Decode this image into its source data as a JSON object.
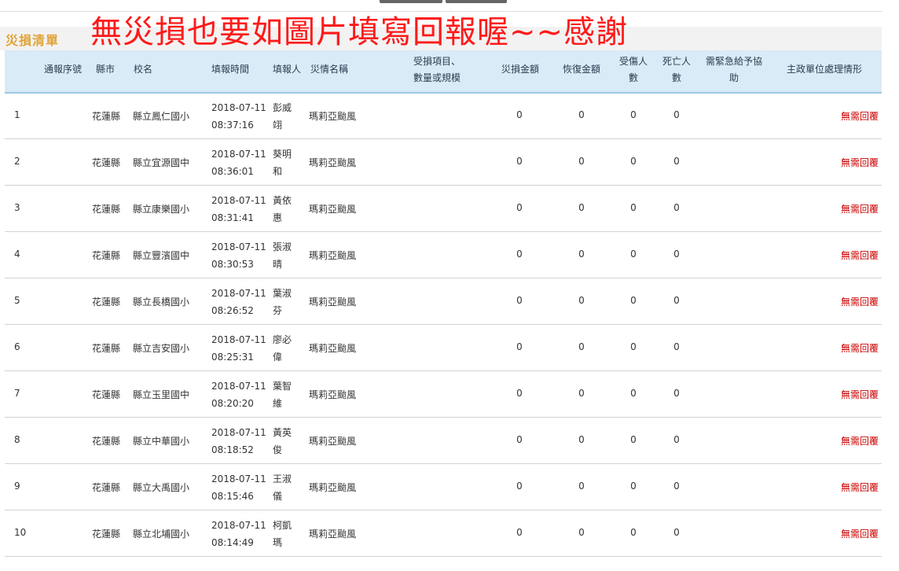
{
  "section_title": "災損清單",
  "annotation": "無災損也要如圖片填寫回報喔~~感謝",
  "headers": {
    "seq": "通報序號",
    "county": "縣市",
    "school": "校名",
    "time": "填報時間",
    "reporter": "填報人",
    "disaster": "災情名稱",
    "items_l1": "受損項目、",
    "items_l2": "數量或規模",
    "loss": "災損金額",
    "recovery": "恢復金額",
    "injured_l1": "受傷人",
    "injured_l2": "數",
    "dead_l1": "死亡人",
    "dead_l2": "數",
    "urgent_l1": "需緊急給予協",
    "urgent_l2": "助",
    "handling": "主政單位處理情形"
  },
  "rows": [
    {
      "seq": "1",
      "county": "花蓮縣",
      "school": "縣立鳳仁國小",
      "date": "2018-07-11",
      "time": "08:37:16",
      "name1": "彭威",
      "name2": "翊",
      "disaster": "瑪莉亞颱風",
      "loss": "0",
      "recovery": "0",
      "injured": "0",
      "dead": "0",
      "status": "無需回覆"
    },
    {
      "seq": "2",
      "county": "花蓮縣",
      "school": "縣立宜源國中",
      "date": "2018-07-11",
      "time": "08:36:01",
      "name1": "葵明",
      "name2": "和",
      "disaster": "瑪莉亞颱風",
      "loss": "0",
      "recovery": "0",
      "injured": "0",
      "dead": "0",
      "status": "無需回覆"
    },
    {
      "seq": "3",
      "county": "花蓮縣",
      "school": "縣立康樂國小",
      "date": "2018-07-11",
      "time": "08:31:41",
      "name1": "黃依",
      "name2": "惠",
      "disaster": "瑪莉亞颱風",
      "loss": "0",
      "recovery": "0",
      "injured": "0",
      "dead": "0",
      "status": "無需回覆"
    },
    {
      "seq": "4",
      "county": "花蓮縣",
      "school": "縣立豐濱國中",
      "date": "2018-07-11",
      "time": "08:30:53",
      "name1": "張淑",
      "name2": "晴",
      "disaster": "瑪莉亞颱風",
      "loss": "0",
      "recovery": "0",
      "injured": "0",
      "dead": "0",
      "status": "無需回覆"
    },
    {
      "seq": "5",
      "county": "花蓮縣",
      "school": "縣立長橋國小",
      "date": "2018-07-11",
      "time": "08:26:52",
      "name1": "葉淑",
      "name2": "芬",
      "disaster": "瑪莉亞颱風",
      "loss": "0",
      "recovery": "0",
      "injured": "0",
      "dead": "0",
      "status": "無需回覆"
    },
    {
      "seq": "6",
      "county": "花蓮縣",
      "school": "縣立吉安國小",
      "date": "2018-07-11",
      "time": "08:25:31",
      "name1": "廖必",
      "name2": "偉",
      "disaster": "瑪莉亞颱風",
      "loss": "0",
      "recovery": "0",
      "injured": "0",
      "dead": "0",
      "status": "無需回覆"
    },
    {
      "seq": "7",
      "county": "花蓮縣",
      "school": "縣立玉里國中",
      "date": "2018-07-11",
      "time": "08:20:20",
      "name1": "葉智",
      "name2": "維",
      "disaster": "瑪莉亞颱風",
      "loss": "0",
      "recovery": "0",
      "injured": "0",
      "dead": "0",
      "status": "無需回覆"
    },
    {
      "seq": "8",
      "county": "花蓮縣",
      "school": "縣立中華國小",
      "date": "2018-07-11",
      "time": "08:18:52",
      "name1": "黃英",
      "name2": "俊",
      "disaster": "瑪莉亞颱風",
      "loss": "0",
      "recovery": "0",
      "injured": "0",
      "dead": "0",
      "status": "無需回覆"
    },
    {
      "seq": "9",
      "county": "花蓮縣",
      "school": "縣立大禹國小",
      "date": "2018-07-11",
      "time": "08:15:46",
      "name1": "王淑",
      "name2": "儀",
      "disaster": "瑪莉亞颱風",
      "loss": "0",
      "recovery": "0",
      "injured": "0",
      "dead": "0",
      "status": "無需回覆"
    },
    {
      "seq": "10",
      "county": "花蓮縣",
      "school": "縣立北埔國小",
      "date": "2018-07-11",
      "time": "08:14:49",
      "name1": "柯凱",
      "name2": "瑪",
      "disaster": "瑪莉亞颱風",
      "loss": "0",
      "recovery": "0",
      "injured": "0",
      "dead": "0",
      "status": "無需回覆"
    }
  ]
}
